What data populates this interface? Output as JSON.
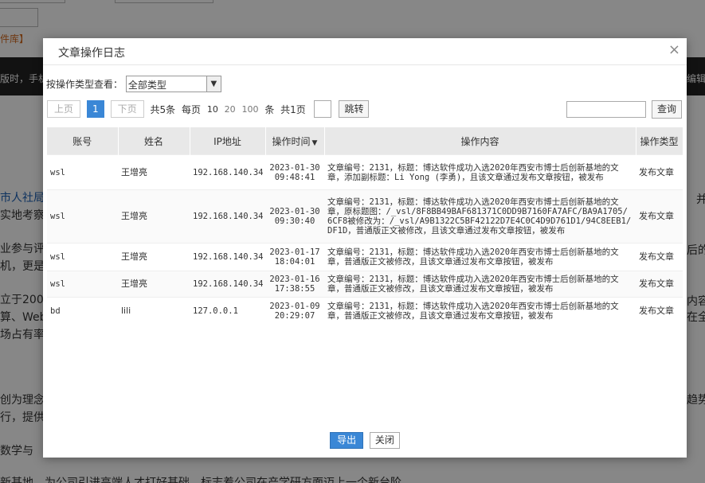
{
  "background": {
    "band_left": "版时，手机",
    "band_right": "编辑",
    "orange_link": "件库】",
    "lines": [
      {
        "text": "市人社局"
      },
      {
        "text": "实地考察"
      },
      {
        "text": "业参与评"
      },
      {
        "text": "机，更是"
      },
      {
        "text": "立于200"
      },
      {
        "text": "算、Web"
      },
      {
        "text": "场占有率"
      },
      {
        "text": "创为理念"
      },
      {
        "text": "行，提供"
      },
      {
        "text": "数学与"
      },
      {
        "text": "新基地，为公司引进高端人才打好基础，标志着公司在产学研方面迈上一个新台阶。"
      }
    ],
    "right_fragments": [
      "并",
      "后的",
      "内容",
      "在全",
      "趋势"
    ]
  },
  "dialog": {
    "title": "文章操作日志",
    "close_symbol": "×",
    "filter": {
      "label": "按操作类型查看：",
      "selected": "全部类型",
      "arrow": "▼"
    },
    "pager": {
      "prev": "上页",
      "current": "1",
      "next": "下页",
      "total": "共5条",
      "per_page_label": "每页",
      "sizes": [
        "10",
        "20",
        "100"
      ],
      "unit": "条",
      "pages": "共1页",
      "jump": "跳转"
    },
    "search": {
      "value": "",
      "button": "查询"
    },
    "table": {
      "headers": {
        "account": "账号",
        "name": "姓名",
        "ip": "IP地址",
        "time": "操作时间",
        "time_sort": "▼",
        "content": "操作内容",
        "type": "操作类型"
      },
      "rows": [
        {
          "account": "wsl",
          "name": "王增亮",
          "ip": "192.168.140.34",
          "date": "2023-01-30",
          "clock": "09:48:41",
          "content": "文章编号：2131，标题：博达软件成功入选2020年西安市博士后创新基地的文章，添加副标题：Li Yong (李勇)，且该文章通过发布文章按钮，被发布",
          "type": "发布文章"
        },
        {
          "account": "wsl",
          "name": "王增亮",
          "ip": "192.168.140.34",
          "date": "2023-01-30",
          "clock": "09:30:40",
          "content": "文章编号：2131，标题：博达软件成功入选2020年西安市博士后创新基地的文章，原标题图：/_vsl/8F8BB49BAF681371C0DD9B7160FA7AFC/BA9A1705/6CF8被修改为：/_vsl/A9B1322C5BF42122D7E4C0C4D9D761D1/94C8EEB1/DF1D，普通版正文被修改，且该文章通过发布文章按钮，被发布",
          "type": "发布文章"
        },
        {
          "account": "wsl",
          "name": "王增亮",
          "ip": "192.168.140.34",
          "date": "2023-01-17",
          "clock": "18:04:01",
          "content": "文章编号：2131，标题：博达软件成功入选2020年西安市博士后创新基地的文章，普通版正文被修改，且该文章通过发布文章按钮，被发布",
          "type": "发布文章"
        },
        {
          "account": "wsl",
          "name": "王增亮",
          "ip": "192.168.140.34",
          "date": "2023-01-16",
          "clock": "17:38:55",
          "content": "文章编号：2131，标题：博达软件成功入选2020年西安市博士后创新基地的文章，普通版正文被修改，且该文章通过发布文章按钮，被发布",
          "type": "发布文章"
        },
        {
          "account": "bd",
          "name": "lili",
          "ip": "127.0.0.1",
          "date": "2023-01-09",
          "clock": "20:29:07",
          "content": "文章编号：2131，标题：博达软件成功入选2020年西安市博士后创新基地的文章，普通版正文被修改，且该文章通过发布文章按钮，被发布",
          "type": "发布文章"
        }
      ]
    },
    "footer": {
      "export": "导出",
      "close": "关闭"
    }
  },
  "colors": {
    "primary": "#3a87d6",
    "overlay": "rgba(0,0,0,0.47)",
    "header_bg": "#e8e8e8"
  }
}
